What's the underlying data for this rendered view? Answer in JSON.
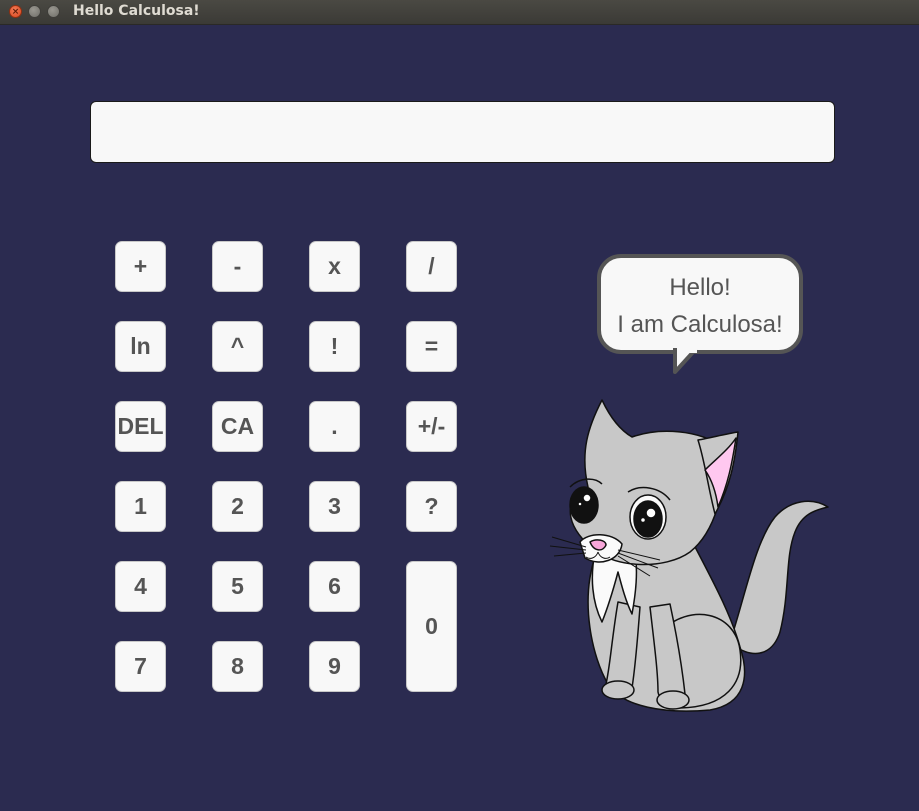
{
  "window": {
    "title": "Hello Calculosa!"
  },
  "display": {
    "value": ""
  },
  "keys": {
    "plus": "+",
    "minus": "-",
    "times": "x",
    "divide": "/",
    "ln": "ln",
    "power": "^",
    "factorial": "!",
    "equals": "=",
    "del": "DEL",
    "ca": "CA",
    "dot": ".",
    "sign": "+/-",
    "one": "1",
    "two": "2",
    "three": "3",
    "help": "?",
    "four": "4",
    "five": "5",
    "six": "6",
    "zero": "0",
    "seven": "7",
    "eight": "8",
    "nine": "9"
  },
  "bubble": {
    "line1": "Hello!",
    "line2": "I am Calculosa!"
  },
  "colors": {
    "background": "#2b2b50",
    "key": "#f8f8f8",
    "key_text": "#555555",
    "cat_gray": "#c8c8c8",
    "ear_pink": "#ffc8f0"
  }
}
